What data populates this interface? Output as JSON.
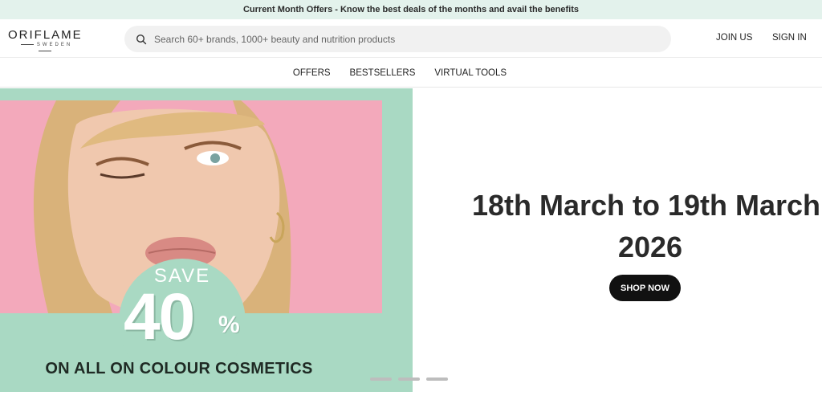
{
  "promo": {
    "text": "Current Month Offers - Know the best deals of the months and avail the benefits"
  },
  "header": {
    "logo": {
      "main": "ORIFLAME",
      "sub": "SWEDEN"
    },
    "search": {
      "placeholder": "Search 60+ brands, 1000+ beauty and nutrition products",
      "icon": "search-icon"
    },
    "join_label": "JOIN US",
    "signin_label": "SIGN IN"
  },
  "nav": {
    "items": [
      {
        "label": "OFFERS"
      },
      {
        "label": "BESTSELLERS"
      },
      {
        "label": "VIRTUAL TOOLS"
      }
    ]
  },
  "hero": {
    "save_word": "SAVE",
    "save_number": "40",
    "save_percent": "%",
    "save_desc": "ON ALL ON COLOUR COSMETICS",
    "date_line1": "18th March to 19th March,",
    "date_line2": "2026",
    "cta_label": "SHOP NOW",
    "carousel_count": 3
  },
  "colors": {
    "promo_bg": "#e3f2ec",
    "banner_green": "#a9d9c3",
    "photo_pink": "#f3a9bb",
    "cta_bg": "#111111"
  }
}
